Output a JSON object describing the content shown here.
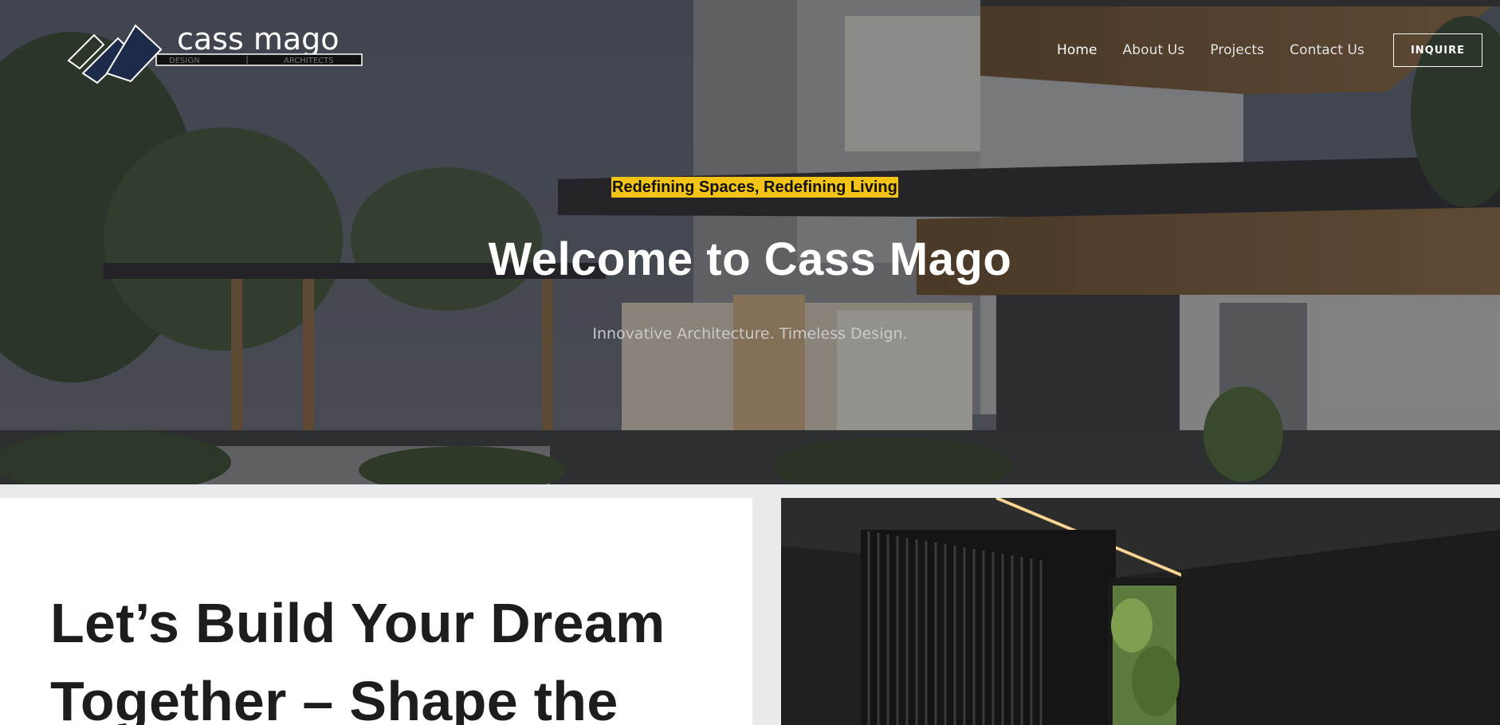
{
  "header": {
    "logo": {
      "wordmark": "cass mago",
      "sub_left": "DESIGN",
      "sub_right": "ARCHITECTS"
    },
    "nav": [
      {
        "label": "Home",
        "active": true
      },
      {
        "label": "About Us",
        "active": false
      },
      {
        "label": "Projects",
        "active": false
      },
      {
        "label": "Contact Us",
        "active": false
      }
    ],
    "cta_label": "INQUIRE"
  },
  "hero": {
    "tagline": "Redefining Spaces, Redefining Living",
    "title": "Welcome to Cass Mago",
    "subtitle": "Innovative Architecture. Timeless Design."
  },
  "section": {
    "heading": "Let’s Build Your Dream Together – Shape the"
  },
  "colors": {
    "accent": "#f3c316",
    "text_dark": "#1d1d1f",
    "page_bg": "#e8ebee"
  }
}
